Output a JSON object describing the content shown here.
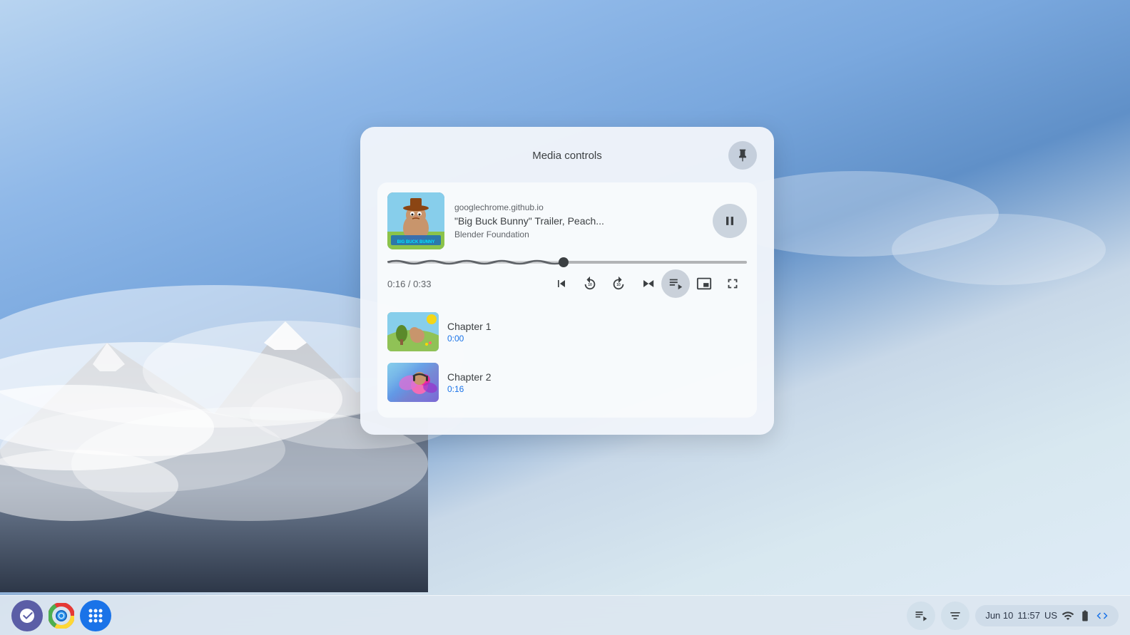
{
  "desktop": {
    "bg_description": "ChromeOS desktop with mountain and clouds"
  },
  "media_panel": {
    "title": "Media controls",
    "pin_label": "Pin",
    "card": {
      "source": "googlechrome.github.io",
      "title": "\"Big Buck Bunny\" Trailer, Peach...",
      "artist": "Blender Foundation",
      "time_current": "0:16",
      "time_total": "0:33",
      "time_display": "0:16 / 0:33",
      "progress_percent": 49
    },
    "controls": {
      "skip_back_label": "Skip to beginning",
      "rewind_label": "Rewind 10 seconds",
      "forward_label": "Forward 10 seconds",
      "next_label": "Next track",
      "playlist_label": "Playlist",
      "pip_label": "Picture in picture",
      "fullscreen_label": "Fullscreen",
      "pause_label": "Pause"
    },
    "chapters": [
      {
        "name": "Chapter 1",
        "time": "0:00"
      },
      {
        "name": "Chapter 2",
        "time": "0:16"
      }
    ]
  },
  "taskbar": {
    "launcher_label": "Launcher",
    "chrome_label": "Google Chrome",
    "apps_label": "App grid",
    "media_icon_label": "Media controls",
    "playlist_icon_label": "Playlist",
    "date": "Jun 10",
    "time": "11:57",
    "locale": "US",
    "wifi_label": "WiFi",
    "battery_label": "Battery",
    "dev_tools_label": "Developer tools"
  }
}
